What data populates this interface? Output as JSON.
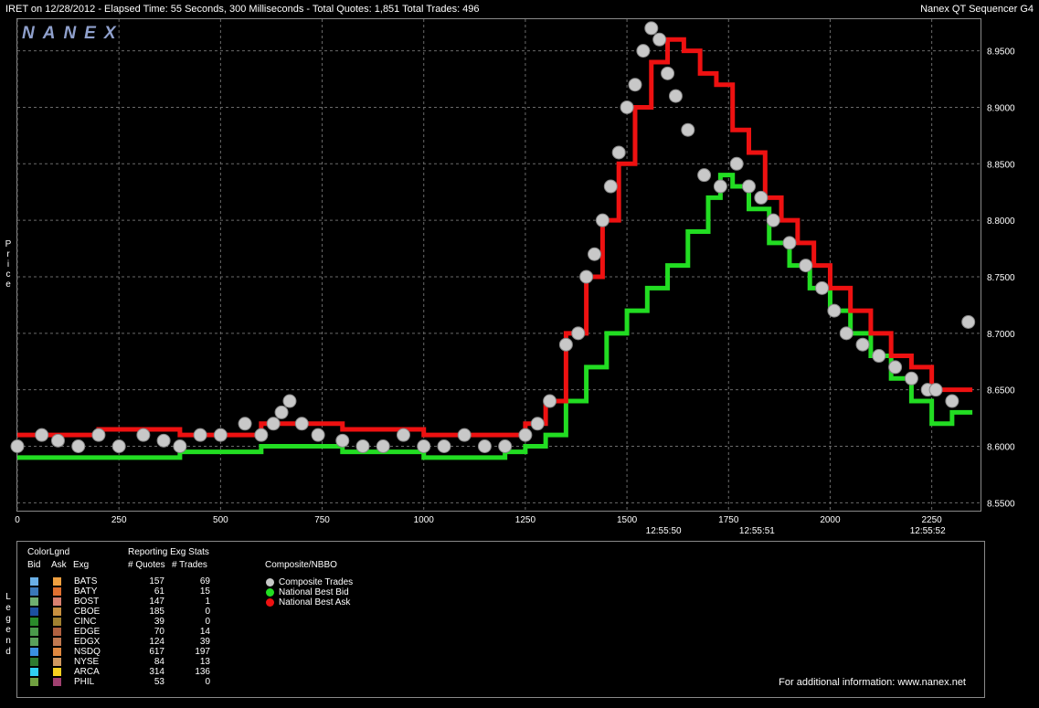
{
  "header": {
    "left": "IRET on 12/28/2012  -  Elapsed Time: 55 Seconds, 300 Milliseconds  -  Total Quotes: 1,851  Total Trades: 496",
    "right": "Nanex QT Sequencer G4"
  },
  "logo": "NANEX",
  "y_axis_label": "Price",
  "legend_side_label": "Legend",
  "colors": {
    "background": "#000000",
    "grid": "#6a6a6a",
    "trades": "#c8c8c8",
    "best_bid": "#22dd22",
    "best_ask": "#ee1111"
  },
  "chart_data": {
    "type": "line",
    "x_ticks": [
      0,
      250,
      500,
      750,
      1000,
      1250,
      1500,
      1750,
      2000,
      2250
    ],
    "x_time_labels": [
      {
        "x": 1590,
        "label": "12:55:50"
      },
      {
        "x": 1820,
        "label": "12:55:51"
      },
      {
        "x": 2240,
        "label": "12:55:52"
      }
    ],
    "xlim": [
      0,
      2370
    ],
    "ylim": [
      8.543,
      8.978
    ],
    "y_ticks": [
      "8.5500",
      "8.6000",
      "8.6500",
      "8.7000",
      "8.7500",
      "8.8000",
      "8.8500",
      "8.9000",
      "8.9500"
    ],
    "y_tick_values": [
      8.55,
      8.6,
      8.65,
      8.7,
      8.75,
      8.8,
      8.85,
      8.9,
      8.95
    ],
    "grid": true,
    "series": [
      {
        "name": "Composite Trades",
        "type": "scatter",
        "points": [
          [
            0,
            8.6
          ],
          [
            60,
            8.61
          ],
          [
            100,
            8.605
          ],
          [
            150,
            8.6
          ],
          [
            200,
            8.61
          ],
          [
            250,
            8.6
          ],
          [
            310,
            8.61
          ],
          [
            360,
            8.605
          ],
          [
            400,
            8.6
          ],
          [
            450,
            8.61
          ],
          [
            500,
            8.61
          ],
          [
            560,
            8.62
          ],
          [
            600,
            8.61
          ],
          [
            630,
            8.62
          ],
          [
            650,
            8.63
          ],
          [
            670,
            8.64
          ],
          [
            700,
            8.62
          ],
          [
            740,
            8.61
          ],
          [
            800,
            8.605
          ],
          [
            850,
            8.6
          ],
          [
            900,
            8.6
          ],
          [
            950,
            8.61
          ],
          [
            1000,
            8.6
          ],
          [
            1050,
            8.6
          ],
          [
            1100,
            8.61
          ],
          [
            1150,
            8.6
          ],
          [
            1200,
            8.6
          ],
          [
            1250,
            8.61
          ],
          [
            1280,
            8.62
          ],
          [
            1310,
            8.64
          ],
          [
            1350,
            8.69
          ],
          [
            1380,
            8.7
          ],
          [
            1400,
            8.75
          ],
          [
            1420,
            8.77
          ],
          [
            1440,
            8.8
          ],
          [
            1460,
            8.83
          ],
          [
            1480,
            8.86
          ],
          [
            1500,
            8.9
          ],
          [
            1520,
            8.92
          ],
          [
            1540,
            8.95
          ],
          [
            1560,
            8.97
          ],
          [
            1580,
            8.96
          ],
          [
            1600,
            8.93
          ],
          [
            1620,
            8.91
          ],
          [
            1650,
            8.88
          ],
          [
            1690,
            8.84
          ],
          [
            1730,
            8.83
          ],
          [
            1770,
            8.85
          ],
          [
            1800,
            8.83
          ],
          [
            1830,
            8.82
          ],
          [
            1860,
            8.8
          ],
          [
            1900,
            8.78
          ],
          [
            1940,
            8.76
          ],
          [
            1980,
            8.74
          ],
          [
            2010,
            8.72
          ],
          [
            2040,
            8.7
          ],
          [
            2080,
            8.69
          ],
          [
            2120,
            8.68
          ],
          [
            2160,
            8.67
          ],
          [
            2200,
            8.66
          ],
          [
            2240,
            8.65
          ],
          [
            2260,
            8.65
          ],
          [
            2300,
            8.64
          ],
          [
            2340,
            8.71
          ]
        ]
      },
      {
        "name": "National Best Bid",
        "type": "line",
        "points": [
          [
            0,
            8.59
          ],
          [
            200,
            8.59
          ],
          [
            400,
            8.595
          ],
          [
            600,
            8.6
          ],
          [
            800,
            8.595
          ],
          [
            1000,
            8.59
          ],
          [
            1200,
            8.595
          ],
          [
            1250,
            8.6
          ],
          [
            1300,
            8.61
          ],
          [
            1350,
            8.64
          ],
          [
            1400,
            8.67
          ],
          [
            1450,
            8.7
          ],
          [
            1500,
            8.72
          ],
          [
            1550,
            8.74
          ],
          [
            1600,
            8.76
          ],
          [
            1650,
            8.79
          ],
          [
            1700,
            8.82
          ],
          [
            1730,
            8.84
          ],
          [
            1760,
            8.83
          ],
          [
            1800,
            8.81
          ],
          [
            1850,
            8.78
          ],
          [
            1900,
            8.76
          ],
          [
            1950,
            8.74
          ],
          [
            2000,
            8.72
          ],
          [
            2050,
            8.7
          ],
          [
            2100,
            8.68
          ],
          [
            2150,
            8.66
          ],
          [
            2200,
            8.64
          ],
          [
            2250,
            8.62
          ],
          [
            2300,
            8.63
          ],
          [
            2350,
            8.63
          ]
        ]
      },
      {
        "name": "National Best Ask",
        "type": "line",
        "points": [
          [
            0,
            8.61
          ],
          [
            200,
            8.615
          ],
          [
            400,
            8.61
          ],
          [
            600,
            8.62
          ],
          [
            800,
            8.615
          ],
          [
            1000,
            8.61
          ],
          [
            1200,
            8.61
          ],
          [
            1250,
            8.62
          ],
          [
            1300,
            8.64
          ],
          [
            1350,
            8.7
          ],
          [
            1400,
            8.75
          ],
          [
            1440,
            8.8
          ],
          [
            1480,
            8.85
          ],
          [
            1520,
            8.9
          ],
          [
            1560,
            8.94
          ],
          [
            1600,
            8.96
          ],
          [
            1640,
            8.95
          ],
          [
            1680,
            8.93
          ],
          [
            1720,
            8.92
          ],
          [
            1760,
            8.88
          ],
          [
            1800,
            8.86
          ],
          [
            1840,
            8.82
          ],
          [
            1880,
            8.8
          ],
          [
            1920,
            8.78
          ],
          [
            1960,
            8.76
          ],
          [
            2000,
            8.74
          ],
          [
            2050,
            8.72
          ],
          [
            2100,
            8.7
          ],
          [
            2150,
            8.68
          ],
          [
            2200,
            8.67
          ],
          [
            2250,
            8.65
          ],
          [
            2300,
            8.65
          ],
          [
            2350,
            8.65
          ]
        ]
      }
    ]
  },
  "legend": {
    "col_headers": {
      "colorlgnd": "ColorLgnd",
      "bid": "Bid",
      "ask": "Ask",
      "exg": "Exg",
      "stats": "Reporting Exg Stats",
      "quotes": "# Quotes",
      "trades": "# Trades",
      "composite": "Composite/NBBO"
    },
    "exchanges": [
      {
        "exg": "BATS",
        "quotes": "157",
        "trades": "69",
        "bid_color": "#6ab0e8",
        "ask_color": "#f0a040"
      },
      {
        "exg": "BATY",
        "quotes": "61",
        "trades": "15",
        "bid_color": "#3a78b8",
        "ask_color": "#e07030"
      },
      {
        "exg": "BOST",
        "quotes": "147",
        "trades": "1",
        "bid_color": "#6fae6f",
        "ask_color": "#d98070"
      },
      {
        "exg": "CBOE",
        "quotes": "185",
        "trades": "0",
        "bid_color": "#1c4fa0",
        "ask_color": "#c89040"
      },
      {
        "exg": "CINC",
        "quotes": "39",
        "trades": "0",
        "bid_color": "#2a8a2a",
        "ask_color": "#a08030"
      },
      {
        "exg": "EDGE",
        "quotes": "70",
        "trades": "14",
        "bid_color": "#4a9a4a",
        "ask_color": "#b06040"
      },
      {
        "exg": "EDGX",
        "quotes": "124",
        "trades": "39",
        "bid_color": "#5aa05a",
        "ask_color": "#c07850"
      },
      {
        "exg": "NSDQ",
        "quotes": "617",
        "trades": "197",
        "bid_color": "#3a90e0",
        "ask_color": "#e08840"
      },
      {
        "exg": "NYSE",
        "quotes": "84",
        "trades": "13",
        "bid_color": "#2f7a2f",
        "ask_color": "#d09860"
      },
      {
        "exg": "ARCA",
        "quotes": "314",
        "trades": "136",
        "bid_color": "#30d0f0",
        "ask_color": "#f8d020"
      },
      {
        "exg": "PHIL",
        "quotes": "53",
        "trades": "0",
        "bid_color": "#70a040",
        "ask_color": "#a04070"
      }
    ],
    "composite": [
      {
        "label": "Composite Trades",
        "color": "#c8c8c8"
      },
      {
        "label": "National Best Bid",
        "color": "#22dd22"
      },
      {
        "label": "National Best Ask",
        "color": "#ee1111"
      }
    ]
  },
  "footer": "For additional information: www.nanex.net"
}
